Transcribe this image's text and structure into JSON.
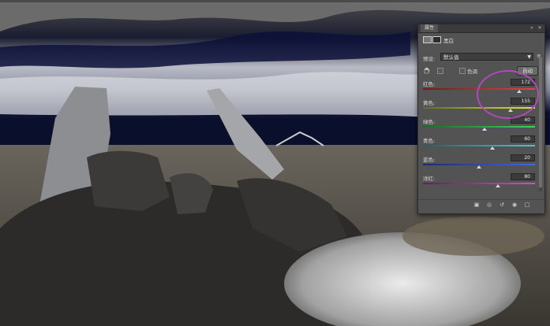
{
  "panel": {
    "tab_title": "属性",
    "adjustment_name": "黑白",
    "preset_label": "预设:",
    "preset_value": "默认值",
    "tint_label": "色调",
    "auto_label": "自动",
    "sliders": [
      {
        "label": "红色:",
        "value": "172",
        "fraction": 0.86,
        "gradient": [
          "#6b1d1d",
          "#e24444"
        ]
      },
      {
        "label": "黄色:",
        "value": "155",
        "fraction": 0.78,
        "gradient": [
          "#6b6a1d",
          "#e8e23c"
        ]
      },
      {
        "label": "绿色:",
        "value": "40",
        "fraction": 0.55,
        "gradient": [
          "#1d6b2a",
          "#3fd05a"
        ]
      },
      {
        "label": "青色:",
        "value": "60",
        "fraction": 0.62,
        "gradient": [
          "#1d636b",
          "#44c8d6"
        ]
      },
      {
        "label": "蓝色:",
        "value": "20",
        "fraction": 0.5,
        "gradient": [
          "#1d2c6b",
          "#4466e0"
        ]
      },
      {
        "label": "洋红:",
        "value": "80",
        "fraction": 0.67,
        "gradient": [
          "#6b1d60",
          "#d84ac4"
        ]
      }
    ],
    "highlight_color": "#b04ab8"
  }
}
